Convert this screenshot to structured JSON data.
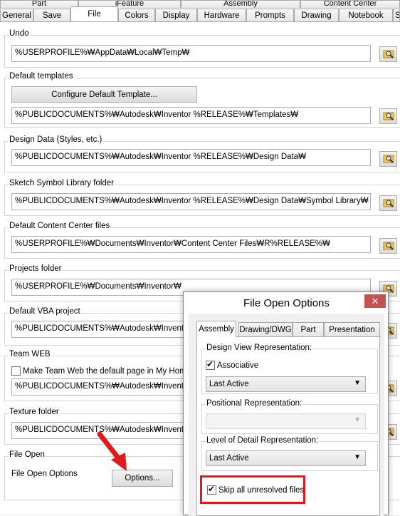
{
  "tabs_back": [
    "Part",
    "iFeature",
    "Assembly",
    "Content Center"
  ],
  "tabs_front": [
    "General",
    "Save",
    "File",
    "Colors",
    "Display",
    "Hardware",
    "Prompts",
    "Drawing",
    "Notebook",
    "S"
  ],
  "undo": {
    "label": "Undo",
    "path": "%USERPROFILE%₩AppData₩Local₩Temp₩"
  },
  "default_templates": {
    "label": "Default templates",
    "button": "Configure Default Template...",
    "path": "%PUBLICDOCUMENTS%₩Autodesk₩Inventor %RELEASE%₩Templates₩"
  },
  "design_data": {
    "label": "Design Data (Styles, etc.)",
    "path": "%PUBLICDOCUMENTS%₩Autodesk₩Inventor %RELEASE%₩Design Data₩"
  },
  "sketch_symbol": {
    "label": "Sketch Symbol Library folder",
    "path": "%PUBLICDOCUMENTS%₩Autodesk₩Inventor %RELEASE%₩Design Data₩Symbol Library₩"
  },
  "content_center": {
    "label": "Default Content Center files",
    "path": "%USERPROFILE%₩Documents₩Inventor₩Content Center Files₩R%RELEASE%₩"
  },
  "projects": {
    "label": "Projects folder",
    "path": "%USERPROFILE%₩Documents₩Inventor₩"
  },
  "vba": {
    "label": "Default VBA project",
    "path": "%PUBLICDOCUMENTS%₩Autodesk₩Inventor %"
  },
  "team_web": {
    "label": "Team WEB",
    "checkbox": "Make Team Web the default page in My Home",
    "path": "%PUBLICDOCUMENTS%₩Autodesk₩Inventor %"
  },
  "texture": {
    "label": "Texture folder",
    "path": "%PUBLICDOCUMENTS%₩Autodesk₩Inventor %"
  },
  "file_open": {
    "label": "File Open",
    "options_label": "File Open Options",
    "button": "Options..."
  },
  "dialog": {
    "title": "File Open Options",
    "close": "✕",
    "tabs": [
      "Assembly",
      "Drawing/DWG",
      "Part",
      "Presentation"
    ],
    "design_view": {
      "label": "Design View Representation:",
      "checkbox": "Associative",
      "select": "Last Active"
    },
    "positional": {
      "label": "Positional Representation:",
      "select": ""
    },
    "lod": {
      "label": "Level of Detail Representation:",
      "select": "Last Active"
    },
    "skip": "Skip all unresolved files"
  },
  "colors": {
    "highlight": "#e8141c",
    "arrow": "#e01b1b",
    "close_bg": "#c75050"
  }
}
